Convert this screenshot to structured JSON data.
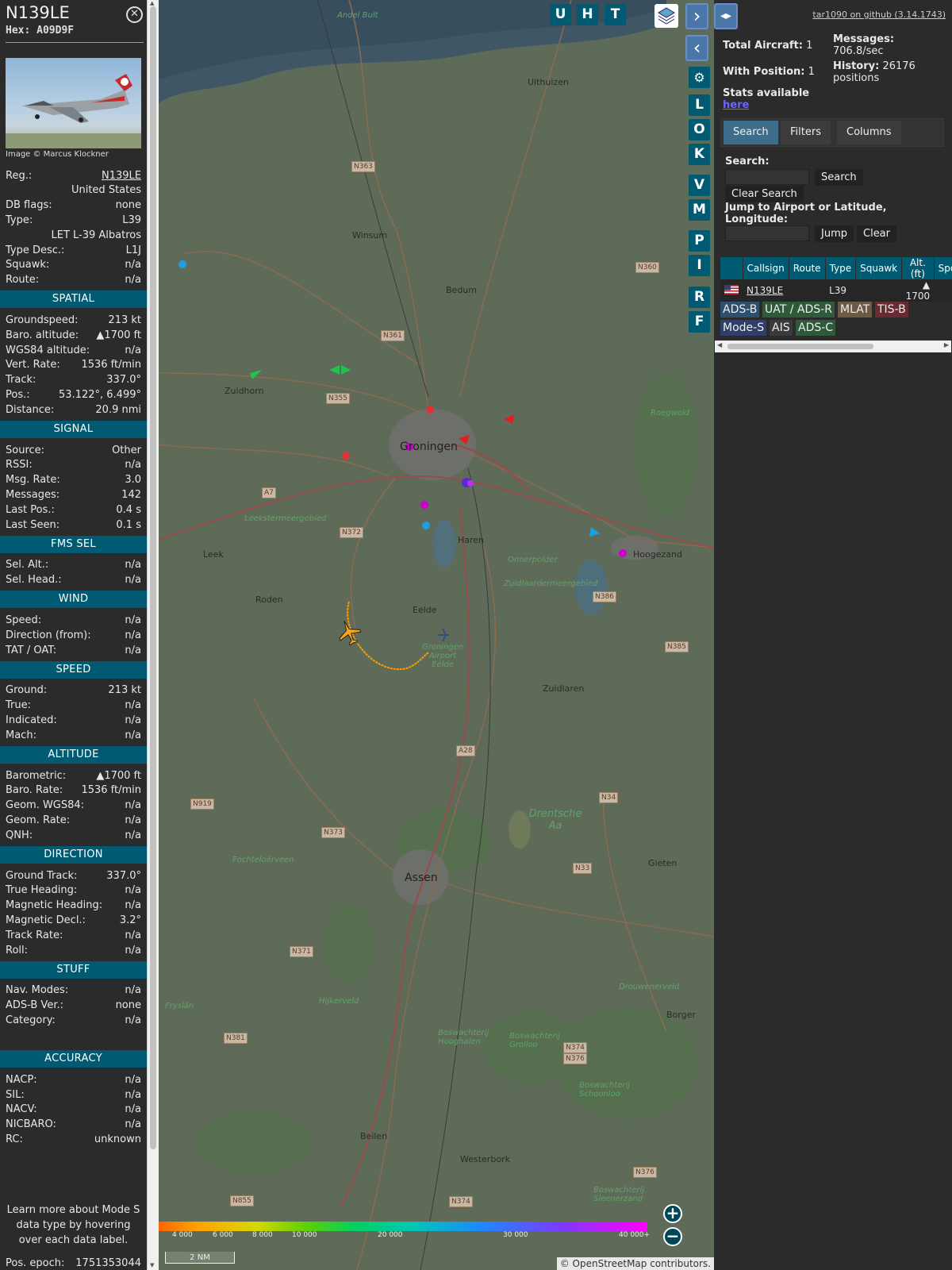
{
  "aircraft": {
    "callsign": "N139LE",
    "hex_label": "Hex:",
    "hex": "A09D9F",
    "photo_credit": "Image © Marcus Klockner",
    "close_icon": "close-circle-icon"
  },
  "info_rows": [
    {
      "k": "Reg.:",
      "v": "N139LE"
    },
    {
      "k": "",
      "v": "United States"
    },
    {
      "k": "DB flags:",
      "v": "none"
    },
    {
      "k": "Type:",
      "v": "L39"
    },
    {
      "k": "",
      "v": "LET L-39 Albatros"
    },
    {
      "k": "Type Desc.:",
      "v": "L1J"
    },
    {
      "k": "Squawk:",
      "v": "n/a"
    },
    {
      "k": "Route:",
      "v": "n/a"
    }
  ],
  "sections": {
    "spatial": {
      "title": "SPATIAL",
      "rows": [
        {
          "k": "Groundspeed:",
          "v": "213 kt"
        },
        {
          "k": "Baro. altitude:",
          "v": "▲1700 ft"
        },
        {
          "k": "WGS84 altitude:",
          "v": "n/a"
        },
        {
          "k": "Vert. Rate:",
          "v": "1536 ft/min"
        },
        {
          "k": "Track:",
          "v": "337.0°"
        },
        {
          "k": "Pos.:",
          "v": "53.122°, 6.499°"
        },
        {
          "k": "Distance:",
          "v": "20.9 nmi"
        }
      ]
    },
    "signal": {
      "title": "SIGNAL",
      "rows": [
        {
          "k": "Source:",
          "v": "Other"
        },
        {
          "k": "RSSI:",
          "v": "n/a"
        },
        {
          "k": "Msg. Rate:",
          "v": "3.0"
        },
        {
          "k": "Messages:",
          "v": "142"
        },
        {
          "k": "Last Pos.:",
          "v": "0.4 s"
        },
        {
          "k": "Last Seen:",
          "v": "0.1 s"
        }
      ]
    },
    "fms": {
      "title": "FMS SEL",
      "rows": [
        {
          "k": "Sel. Alt.:",
          "v": "n/a"
        },
        {
          "k": "Sel. Head.:",
          "v": "n/a"
        }
      ]
    },
    "wind": {
      "title": "WIND",
      "rows": [
        {
          "k": "Speed:",
          "v": "n/a"
        },
        {
          "k": "Direction (from):",
          "v": "n/a"
        },
        {
          "k": "TAT / OAT:",
          "v": "n/a"
        }
      ]
    },
    "speed": {
      "title": "SPEED",
      "rows": [
        {
          "k": "Ground:",
          "v": "213 kt"
        },
        {
          "k": "True:",
          "v": "n/a"
        },
        {
          "k": "Indicated:",
          "v": "n/a"
        },
        {
          "k": "Mach:",
          "v": "n/a"
        }
      ]
    },
    "altitude": {
      "title": "ALTITUDE",
      "rows": [
        {
          "k": "Barometric:",
          "v": "▲1700 ft"
        },
        {
          "k": "Baro. Rate:",
          "v": "1536 ft/min"
        },
        {
          "k": "Geom. WGS84:",
          "v": "n/a"
        },
        {
          "k": "Geom. Rate:",
          "v": "n/a"
        },
        {
          "k": "QNH:",
          "v": "n/a"
        }
      ]
    },
    "direction": {
      "title": "DIRECTION",
      "rows": [
        {
          "k": "Ground Track:",
          "v": "337.0°"
        },
        {
          "k": "True Heading:",
          "v": "n/a"
        },
        {
          "k": "Magnetic Heading:",
          "v": "n/a"
        },
        {
          "k": "Magnetic Decl.:",
          "v": "3.2°"
        },
        {
          "k": "Track Rate:",
          "v": "n/a"
        },
        {
          "k": "Roll:",
          "v": "n/a"
        }
      ]
    },
    "stuff": {
      "title": "STUFF",
      "rows": [
        {
          "k": "Nav. Modes:",
          "v": "n/a"
        },
        {
          "k": "ADS-B Ver.:",
          "v": "none"
        },
        {
          "k": "Category:",
          "v": "n/a"
        }
      ]
    },
    "accuracy": {
      "title": "ACCURACY",
      "rows": [
        {
          "k": "NACP:",
          "v": "n/a"
        },
        {
          "k": "SIL:",
          "v": "n/a"
        },
        {
          "k": "NACV:",
          "v": "n/a"
        },
        {
          "k": "NICBARO:",
          "v": "n/a"
        },
        {
          "k": "RC:",
          "v": "unknown"
        }
      ]
    }
  },
  "learn_more": "Learn more about Mode S data type by hovering over each data label.",
  "pos_epoch": {
    "k": "Pos. epoch:",
    "v": "1751353044"
  },
  "map": {
    "buttons_top": [
      "U",
      "H",
      "T"
    ],
    "buttons_side": [
      "L",
      "O",
      "K",
      "V",
      "M",
      "P",
      "I",
      "R",
      "F"
    ],
    "places": [
      "Andel Bult",
      "Uithuizen",
      "N363",
      "Winsum",
      "Bedum",
      "N360",
      "N361",
      "Zuidhorn",
      "N355",
      "Groningen",
      "Roegwold",
      "A7",
      "Leekstermeergebied",
      "N372",
      "Leek",
      "Haren",
      "Onnerpolder",
      "Hoogezand",
      "Zuidlaardermeergebied",
      "N386",
      "Roden",
      "Eelde",
      "Groningen Airport Eelde",
      "N385",
      "Zuidlaren",
      "A28",
      "N919",
      "N34",
      "Drentsche Aa",
      "N373",
      "Fochteloërveen",
      "N33",
      "Gieten",
      "Assen",
      "N371",
      "Drouwenerveld",
      "Borger",
      "Hijkerveld",
      "N381",
      "Boswachterij Hooghalen",
      "Boswachterij Grolloo",
      "N374",
      "N376",
      "Boswachterij Schoonloo",
      "Beilen",
      "Westerbork",
      "N855",
      "N374",
      "N376",
      "Boswachterij Sleenerzand",
      "Fryslân"
    ],
    "altitude_ticks": [
      "4 000",
      "6 000",
      "8 000",
      "10 000",
      "20 000",
      "30 000",
      "40 000+"
    ],
    "scale": "2 NM",
    "attribution": "© OpenStreetMap contributors.",
    "zoom_in": "+",
    "zoom_out": "−"
  },
  "right": {
    "github": "tar1090 on github (3.14.1743)",
    "total_label": "Total Aircraft:",
    "total": "1",
    "messages_label": "Messages:",
    "messages": "706.8/sec",
    "withpos_label": "With Position:",
    "withpos": "1",
    "history_label": "History:",
    "history": "26176",
    "history_unit": "positions",
    "stats_text": "Stats available",
    "stats_link": "here",
    "tabs": [
      "Search",
      "Filters",
      "Columns"
    ],
    "search_label": "Search:",
    "search_button": "Search",
    "clear_search_button": "Clear Search",
    "jump_label": "Jump to Airport or Latitude, Longitude:",
    "jump_button": "Jump",
    "clear_button": "Clear",
    "table_headers": [
      "",
      "Callsign",
      "Route",
      "Type",
      "Squawk",
      "Alt. (ft)",
      "Spd"
    ],
    "table_row": {
      "flag": "us-flag-icon",
      "callsign": "N139LE",
      "route": "",
      "type": "L39",
      "squawk": "",
      "alt": "▲ 1700",
      "spd": ""
    },
    "sources": [
      {
        "label": "ADS-B",
        "color": "#2e4f6e"
      },
      {
        "label": "UAT / ADS-R",
        "color": "#2f5a3a"
      },
      {
        "label": "MLAT",
        "color": "#6a5a46"
      },
      {
        "label": "TIS-B",
        "color": "#6a2a32"
      },
      {
        "label": "Mode-S",
        "color": "#2e4068"
      },
      {
        "label": "AIS",
        "color": "#3a3a3a"
      },
      {
        "label": "ADS-C",
        "color": "#2f5a3a"
      }
    ]
  }
}
